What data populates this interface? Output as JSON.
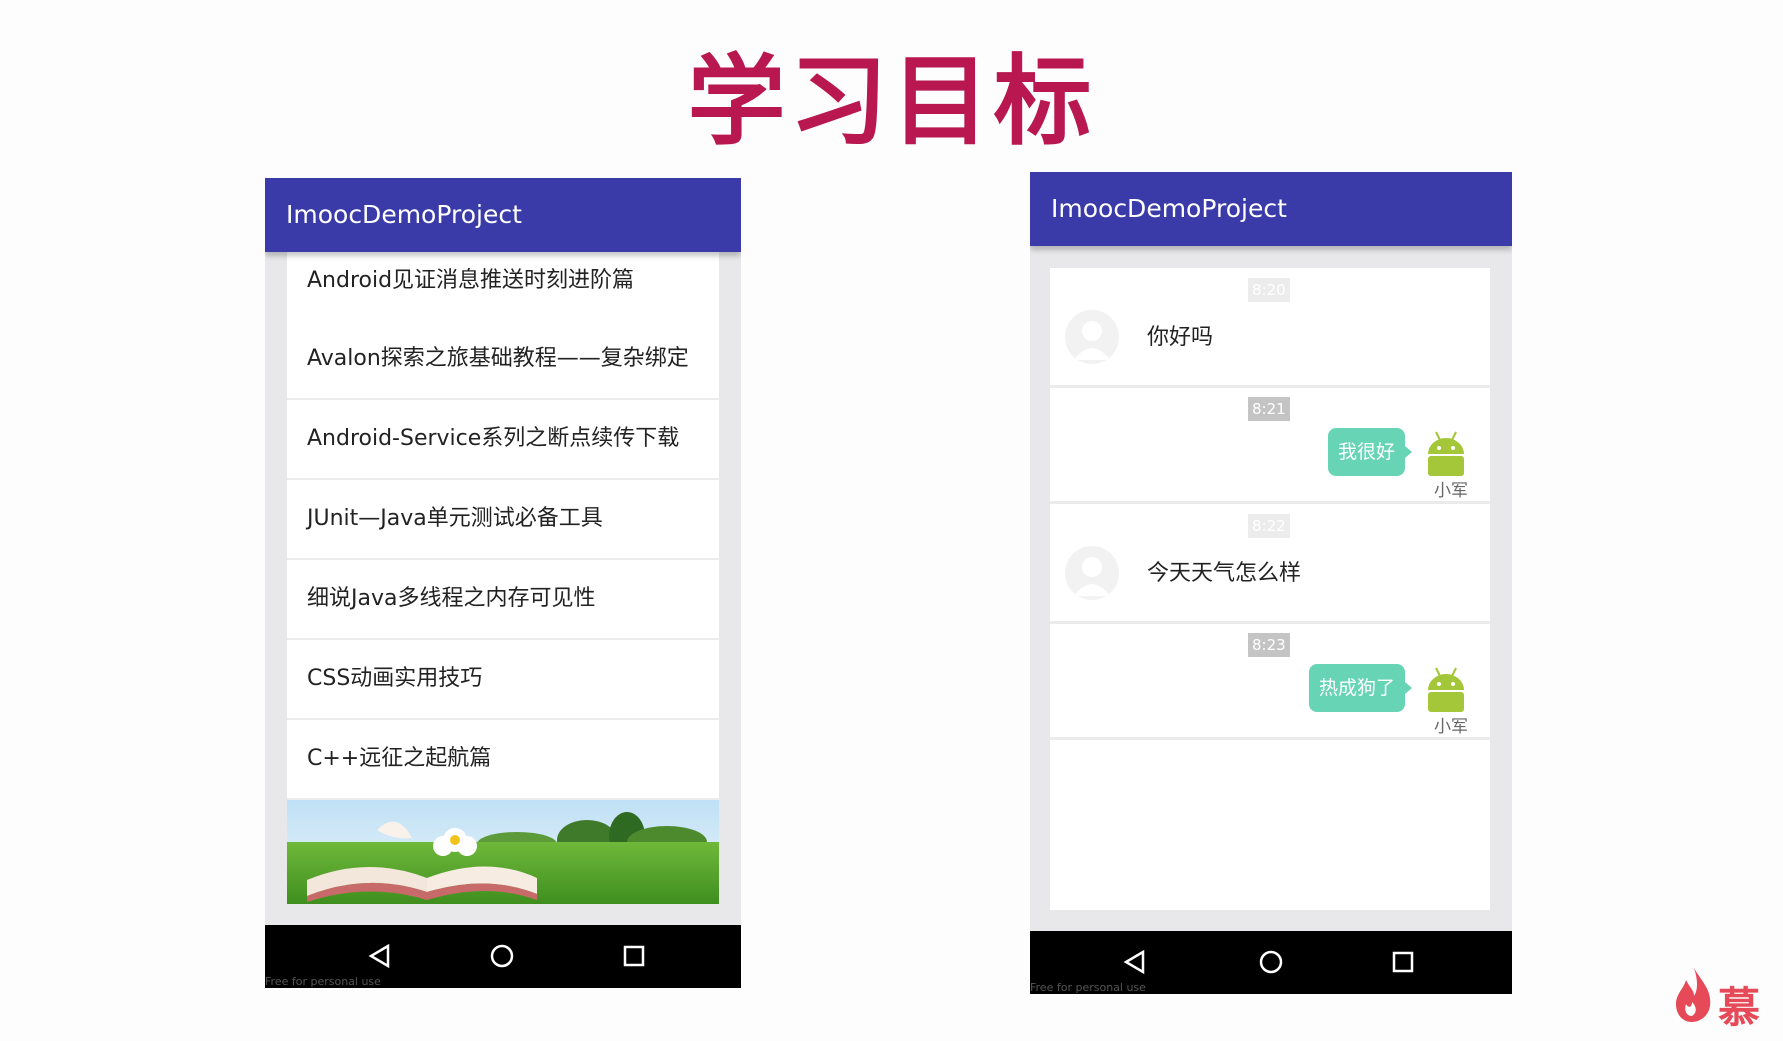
{
  "slide": {
    "title": "学习目标"
  },
  "left_phone": {
    "app_title": "ImoocDemoProject",
    "items": [
      {
        "label": "Android见证消息推送时刻进阶篇"
      },
      {
        "label": "Avalon探索之旅基础教程——复杂绑定"
      },
      {
        "label": "Android-Service系列之断点续传下载"
      },
      {
        "label": "JUnit—Java单元测试必备工具"
      },
      {
        "label": "细说Java多线程之内存可见性"
      },
      {
        "label": "CSS动画实用技巧"
      },
      {
        "label": "C++远征之起航篇"
      }
    ],
    "watermark": "Free for personal use"
  },
  "right_phone": {
    "app_title": "ImoocDemoProject",
    "messages": [
      {
        "time": "8:20",
        "text": "你好吗",
        "side": "left"
      },
      {
        "time": "8:21",
        "text": "我很好",
        "side": "right",
        "nick": "小军"
      },
      {
        "time": "8:22",
        "text": "今天天气怎么样",
        "side": "left"
      },
      {
        "time": "8:23",
        "text": "热成狗了",
        "side": "right",
        "nick": "小军"
      }
    ],
    "watermark": "Free for personal use"
  },
  "colors": {
    "title": "#b8174f",
    "appbar": "#3a3aa8",
    "bubble": "#67d5b5",
    "android_green": "#a4c639"
  },
  "icons": [
    "back-icon",
    "home-icon",
    "recents-icon",
    "avatar-icon",
    "android-robot-icon"
  ],
  "brand": {
    "text": "慕"
  }
}
